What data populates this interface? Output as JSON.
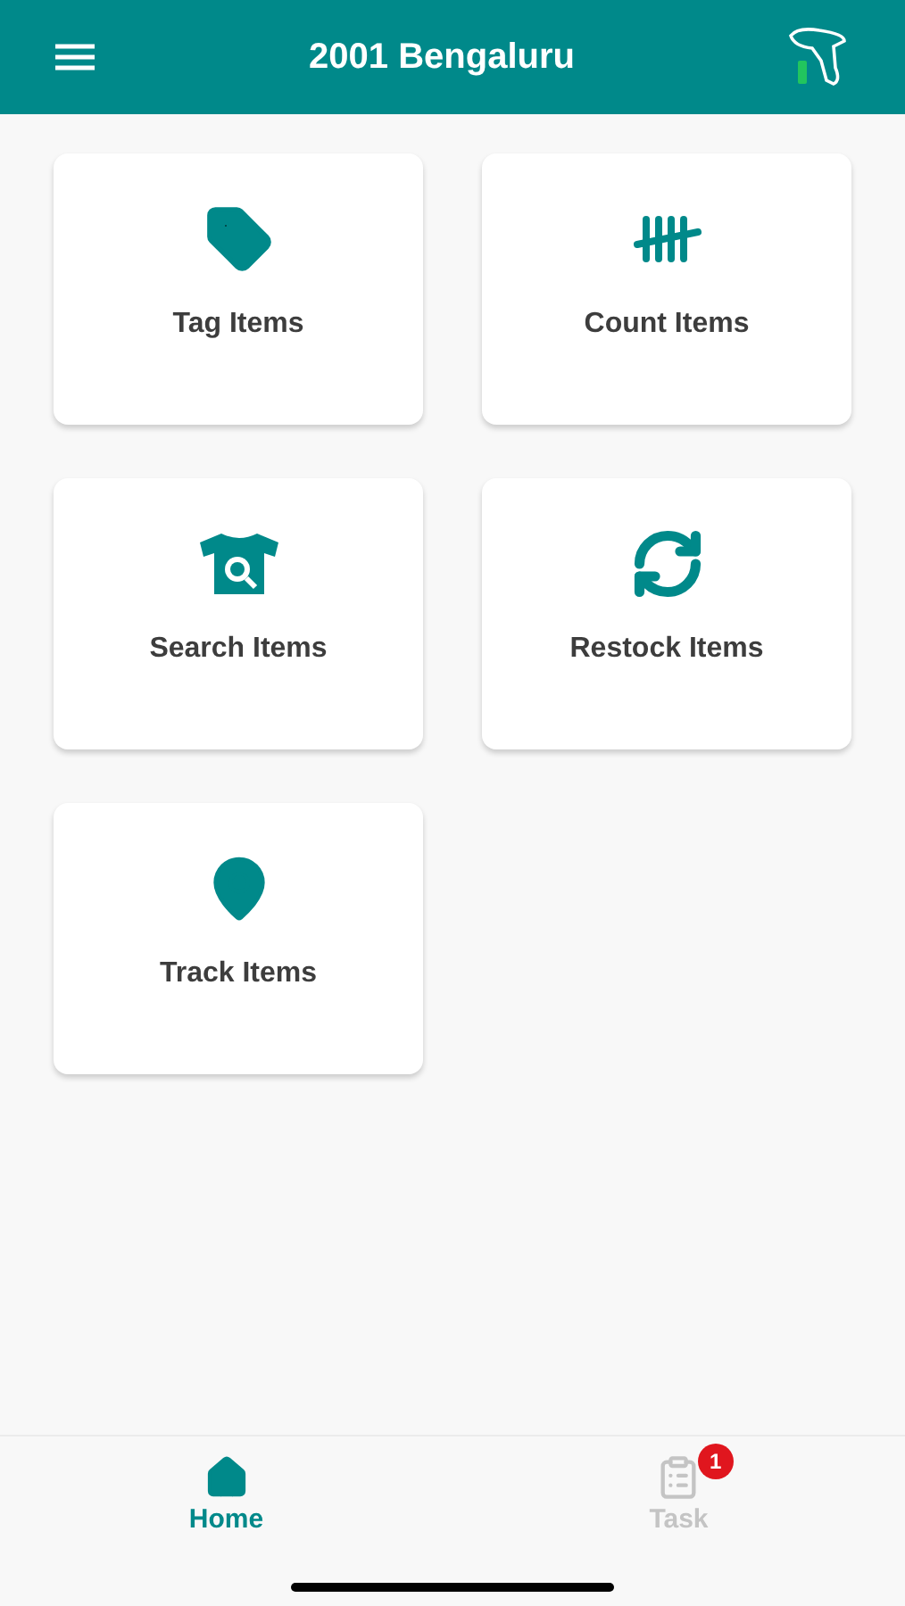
{
  "header": {
    "title": "2001 Bengaluru"
  },
  "tiles": [
    {
      "label": "Tag Items",
      "kind": "tag"
    },
    {
      "label": "Count Items",
      "kind": "count"
    },
    {
      "label": "Search Items",
      "kind": "search"
    },
    {
      "label": "Restock Items",
      "kind": "restock"
    },
    {
      "label": "Track Items",
      "kind": "track"
    }
  ],
  "nav": [
    {
      "label": "Home",
      "kind": "home",
      "selected": true
    },
    {
      "label": "Task",
      "kind": "task",
      "selected": false,
      "badge": "1"
    }
  ]
}
